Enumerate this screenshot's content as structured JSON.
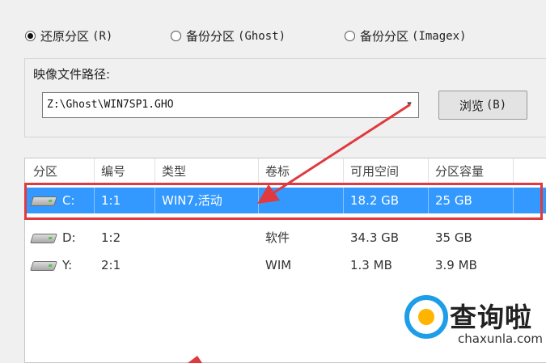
{
  "options": {
    "restore_label": "还原分区",
    "restore_key": "(R)",
    "backup_ghost_label": "备份分区",
    "backup_ghost_key": "(Ghost)",
    "backup_imagex_label": "备份分区",
    "backup_imagex_key": "(Imagex)",
    "selected": "restore"
  },
  "image_path": {
    "label": "映像文件路径:",
    "value": "Z:\\Ghost\\WIN7SP1.GHO",
    "dropdown_icon": "chevron-down-icon",
    "browse_label": "浏览",
    "browse_key": "(B)"
  },
  "partition_table": {
    "headers": [
      "分区",
      "编号",
      "类型",
      "卷标",
      "可用空间",
      "分区容量"
    ],
    "rows": [
      {
        "drive": "C:",
        "num": "1:1",
        "type": "WIN7,活动",
        "label": "",
        "free": "18.2 GB",
        "size": "25 GB"
      },
      {
        "drive": "D:",
        "num": "1:2",
        "type": "",
        "label": "软件",
        "free": "34.3 GB",
        "size": "35 GB"
      },
      {
        "drive": "Y:",
        "num": "2:1",
        "type": "",
        "label": "WIM",
        "free": "1.3 MB",
        "size": "3.9 MB"
      }
    ],
    "selected_row": 0,
    "selection_color": "#3399ff",
    "annotation_color": "#e0393e"
  },
  "watermark": {
    "name": "查询啦",
    "url": "chaxunla.com",
    "brand_blue": "#1e9ee8",
    "brand_orange": "#ffb400"
  }
}
